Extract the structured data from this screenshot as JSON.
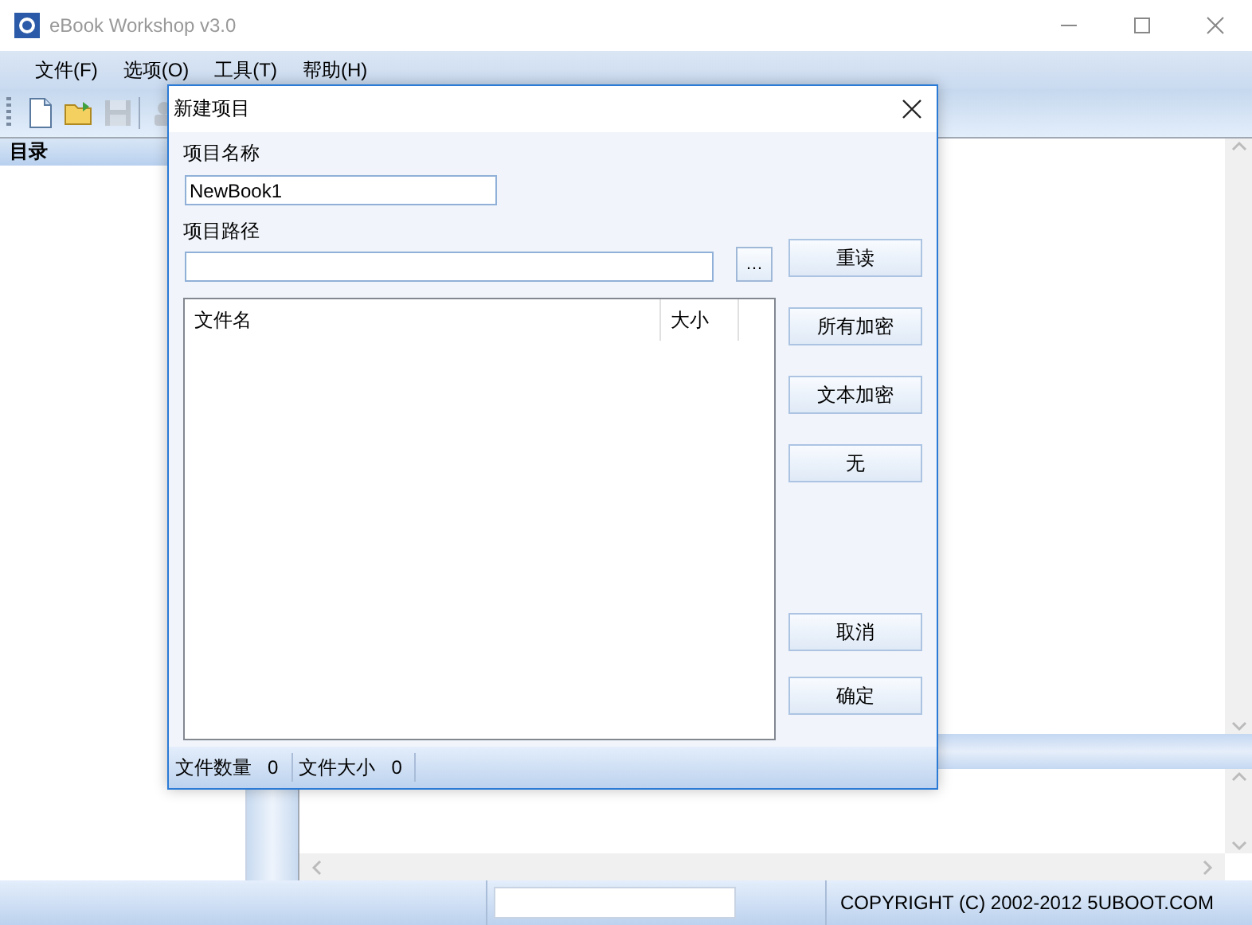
{
  "window": {
    "title": "eBook Workshop v3.0"
  },
  "menu": [
    {
      "label": "文件(F)"
    },
    {
      "label": "选项(O)"
    },
    {
      "label": "工具(T)"
    },
    {
      "label": "帮助(H)"
    }
  ],
  "toolbar": [
    {
      "kind": "new",
      "disabled": false
    },
    {
      "kind": "open",
      "disabled": false
    },
    {
      "kind": "save",
      "disabled": true
    },
    {
      "kind": "tool",
      "disabled": true
    }
  ],
  "sidebar": {
    "title": "目录"
  },
  "status_bar": {
    "copyright": "COPYRIGHT (C) 2002-2012 5UBOOT.COM"
  },
  "dialog": {
    "title": "新建项目",
    "name_label": "项目名称",
    "name_value": "NewBook1",
    "path_label": "项目路径",
    "browse_button": "…",
    "file_list": {
      "columns": [
        "文件名",
        "大小"
      ]
    },
    "buttons": [
      {
        "label": "重读",
        "kind": "top"
      },
      {
        "label": "所有加密",
        "kind": "top"
      },
      {
        "label": "文本加密",
        "kind": "top"
      },
      {
        "label": "无",
        "kind": "top"
      },
      {
        "label": "取消",
        "kind": "bottom"
      },
      {
        "label": "确定",
        "kind": "bottom"
      }
    ],
    "footer": [
      {
        "label": "文件数量",
        "value": "0"
      },
      {
        "label": "文件大小",
        "value": "0"
      }
    ]
  }
}
